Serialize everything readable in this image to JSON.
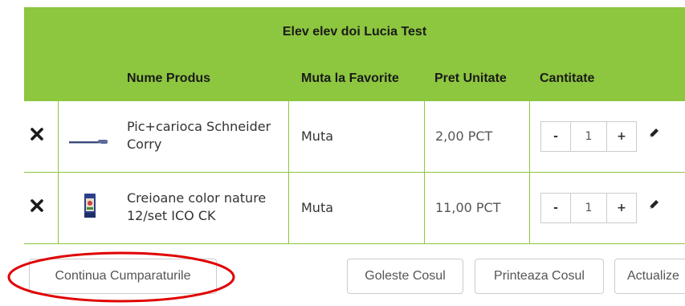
{
  "cart": {
    "user": "Elev elev doi Lucia Test",
    "columns": {
      "name": "Nume Produs",
      "favorite": "Muta la Favorite",
      "price": "Pret Unitate",
      "quantity": "Cantitate"
    },
    "items": [
      {
        "name": "Pic+carioca Schneider Corry",
        "favorite": "Muta",
        "price": "2,00 PCT",
        "quantity": "1",
        "thumb": "pen-icon"
      },
      {
        "name": "Creioane color nature 12/set ICO CK",
        "favorite": "Muta",
        "price": "11,00 PCT",
        "quantity": "1",
        "thumb": "pencil-box-icon"
      }
    ],
    "minus": "-",
    "plus": "+"
  },
  "actions": {
    "continue": "Continua Cumparaturile",
    "empty": "Goleste Cosul",
    "print": "Printeaza Cosul",
    "update": "Actualize"
  },
  "colors": {
    "header": "#8dc63f",
    "annotation": "#e00000"
  },
  "icons": {
    "remove": "close-icon",
    "edit": "pencil-icon"
  }
}
